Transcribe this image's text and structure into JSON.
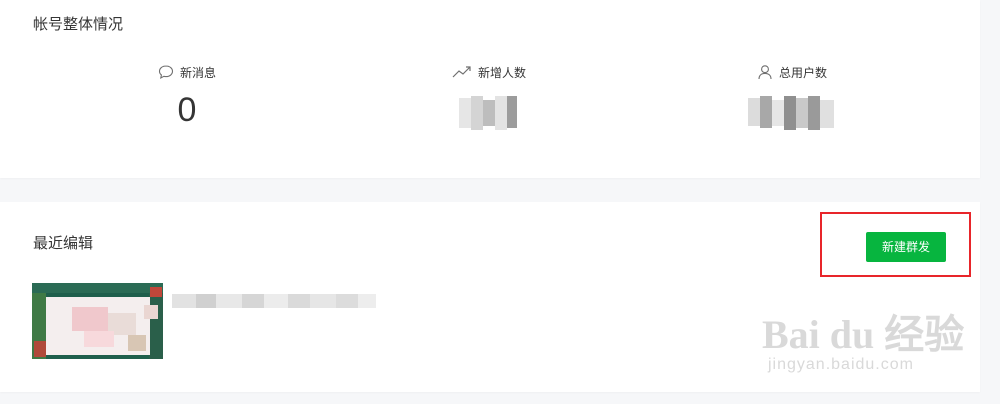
{
  "overview": {
    "title": "帐号整体情况",
    "stats": [
      {
        "label": "新消息",
        "value": "0",
        "icon": "chat-bubble-icon"
      },
      {
        "label": "新增人数",
        "value": "",
        "icon": "trend-up-icon"
      },
      {
        "label": "总用户数",
        "value": "",
        "icon": "user-icon"
      }
    ]
  },
  "recent": {
    "title": "最近编辑",
    "publish_button": "新建群发"
  },
  "watermark": {
    "brand": "Bai du 经验",
    "url": "jingyan.baidu.com"
  },
  "colors": {
    "accent_green": "#07b53f",
    "highlight_red": "#e8252a",
    "background": "#f6f7f9"
  }
}
